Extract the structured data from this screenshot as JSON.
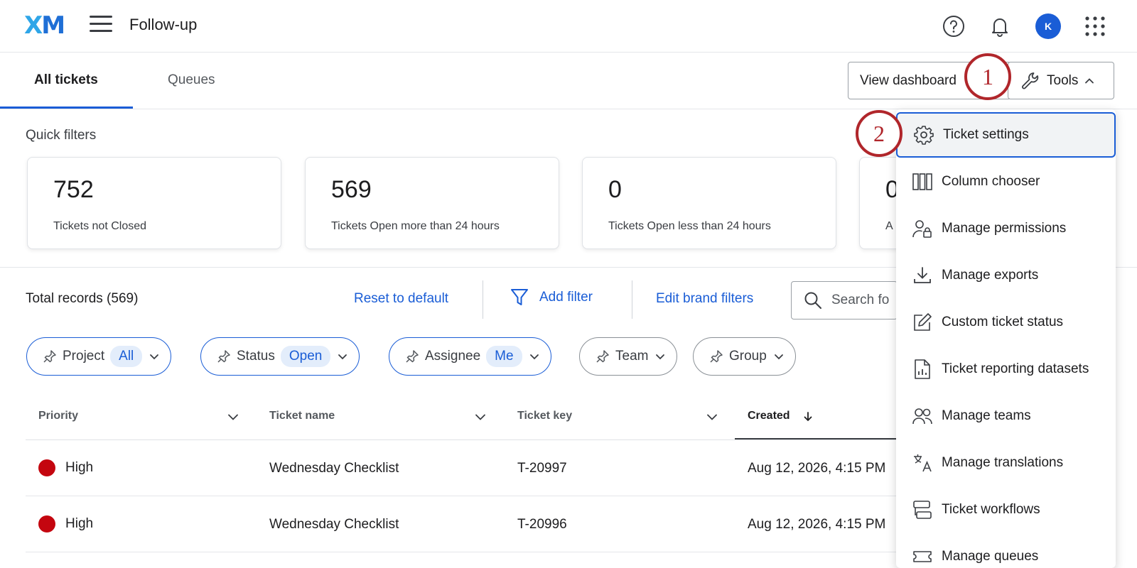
{
  "header": {
    "logo_x": "X",
    "logo_m": "M",
    "title": "Follow-up",
    "avatar_initial": "K",
    "icons": [
      "help-icon",
      "bell-icon",
      "apps-grid-icon"
    ]
  },
  "tabs": [
    {
      "label": "All tickets",
      "active": true
    },
    {
      "label": "Queues",
      "active": false
    }
  ],
  "actions": {
    "view_dashboard": "View dashboard",
    "tools": "Tools"
  },
  "steps": [
    "1",
    "2"
  ],
  "quick_filters": {
    "label": "Quick filters",
    "cards": [
      {
        "value": "752",
        "label": "Tickets not Closed"
      },
      {
        "value": "569",
        "label": "Tickets Open more than 24 hours"
      },
      {
        "value": "0",
        "label": "Tickets Open less than 24 hours"
      },
      {
        "value": "0",
        "label": "A"
      }
    ]
  },
  "toolbar": {
    "total_records": "Total records (569)",
    "reset": "Reset to default",
    "add_filter": "Add filter",
    "edit_brand": "Edit brand filters",
    "search_placeholder": "Search fo"
  },
  "chips": [
    {
      "label": "Project",
      "value": "All"
    },
    {
      "label": "Status",
      "value": "Open"
    },
    {
      "label": "Assignee",
      "value": "Me"
    },
    {
      "label": "Team"
    },
    {
      "label": "Group"
    }
  ],
  "table": {
    "columns": [
      "Priority",
      "Ticket name",
      "Ticket key",
      "Created"
    ],
    "rows": [
      {
        "priority": "High",
        "name": "Wednesday Checklist",
        "key": "T-20997",
        "created": "Aug 12, 2026, 4:15 PM"
      },
      {
        "priority": "High",
        "name": "Wednesday Checklist",
        "key": "T-20996",
        "created": "Aug 12, 2026, 4:15 PM"
      }
    ]
  },
  "tools_menu": [
    {
      "label": "Ticket settings",
      "icon": "gear-icon"
    },
    {
      "label": "Column chooser",
      "icon": "columns-icon"
    },
    {
      "label": "Manage permissions",
      "icon": "user-lock-icon"
    },
    {
      "label": "Manage exports",
      "icon": "download-icon"
    },
    {
      "label": "Custom ticket status",
      "icon": "edit-icon"
    },
    {
      "label": "Ticket reporting datasets",
      "icon": "report-file-icon"
    },
    {
      "label": "Manage teams",
      "icon": "users-icon"
    },
    {
      "label": "Manage translations",
      "icon": "translate-icon"
    },
    {
      "label": "Ticket workflows",
      "icon": "workflow-icon"
    },
    {
      "label": "Manage queues",
      "icon": "ticket-icon"
    }
  ],
  "colors": {
    "accent": "#1a5dd6",
    "step_badge": "#b0262b",
    "priority_high": "#c4060f"
  }
}
